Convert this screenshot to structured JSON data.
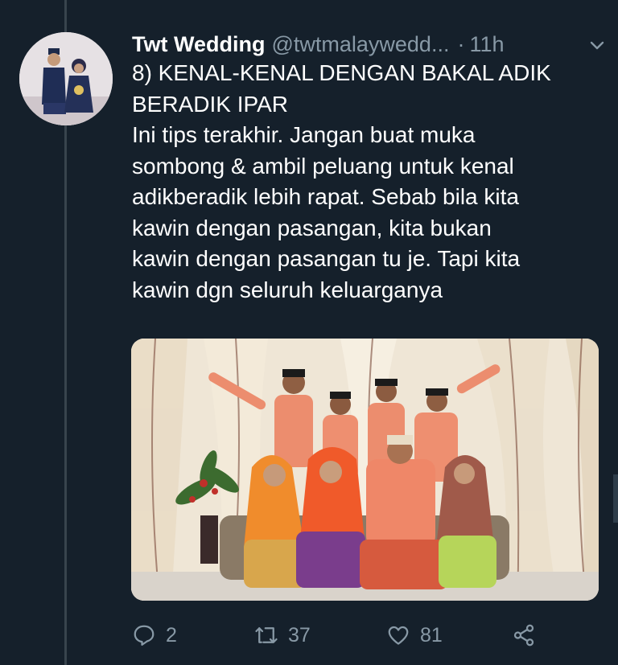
{
  "tweet": {
    "author_name": "Twt Wedding",
    "author_handle": "@twtmalaywedd...",
    "separator": "·",
    "time": "11h",
    "heading_lines": [
      "8) KENAL-KENAL DENGAN BAKAL ADIK",
      "BERADIK IPAR"
    ],
    "body_lines": [
      "Ini tips terakhir. Jangan buat muka",
      "sombong & ambil peluang untuk kenal",
      "adikberadik lebih rapat. Sebab bila kita",
      "kawin dengan pasangan, kita bukan",
      "kawin dengan pasangan tu je. Tapi kita",
      "kawin dgn seluruh keluarganya"
    ]
  },
  "actions": {
    "reply_count": "2",
    "retweet_count": "37",
    "like_count": "81"
  },
  "icons": [
    "avatar-image",
    "chevron-down-icon",
    "reply-icon",
    "retweet-icon",
    "like-icon",
    "share-icon"
  ],
  "colors": {
    "background": "#15202b",
    "secondary_text": "#8899a6",
    "thread_line": "#38444d"
  }
}
